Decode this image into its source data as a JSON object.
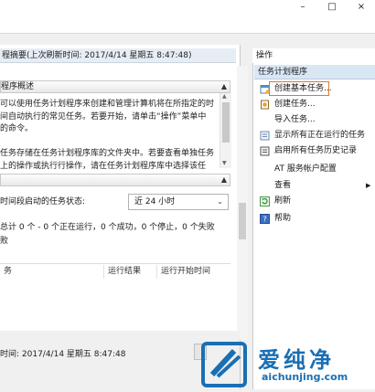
{
  "window": {
    "minimize_glyph": "–",
    "maximize_glyph": "□",
    "close_glyph": "×"
  },
  "summary_header": "程摘要(上次刷新时间: 2017/4/14 星期五 8:47:48)",
  "overview": {
    "title": "程序概述",
    "lines": [
      "可以使用任务计划程序来创建和管理计算机将在所指定的时",
      "间自动执行的常见任务。若要开始，请单击“操作”菜单中",
      "的命令。",
      "",
      "任务存储在任务计划程序库的文件夹中。若要查看单独任务",
      "上的操作或执行行操作，请在任务计划程序库中选择该任"
    ]
  },
  "status": {
    "title": "",
    "period_label": "时间段启动的任务状态:",
    "period_value": "近 24 小时",
    "summary": "总计 0 个 - 0 个正在运行，0 个成功，0 个停止，0 个失败",
    "summary_tail": "败"
  },
  "table": {
    "columns": [
      "务",
      "运行结果",
      "运行开始时间"
    ]
  },
  "footer": {
    "refresh_time": "时间: 2017/4/14 星期五 8:47:48"
  },
  "actions": {
    "header": "操作",
    "group": "任务计划程序",
    "items": [
      {
        "label": "创建基本任务...",
        "icon": "calendar-wizard-icon"
      },
      {
        "label": "创建任务...",
        "icon": "task-icon"
      },
      {
        "label": "导入任务...",
        "icon": "none"
      },
      {
        "label": "显示所有正在运行的任务",
        "icon": "list-icon"
      },
      {
        "label": "启用所有任务历史记录",
        "icon": "history-icon"
      },
      {
        "label": "AT 服务帐户配置",
        "icon": "none"
      },
      {
        "label": "查看",
        "icon": "none"
      },
      {
        "label": "刷新",
        "icon": "refresh-icon"
      },
      {
        "label": "帮助",
        "icon": "help-icon"
      }
    ],
    "submenu_glyph": "▶"
  },
  "watermark": {
    "brand": "爱纯净",
    "domain": "aichunjing.com"
  },
  "colors": {
    "highlight": "#e0782b",
    "group_bg": "#d9e6f4",
    "watermark": "#1a6fb4"
  }
}
